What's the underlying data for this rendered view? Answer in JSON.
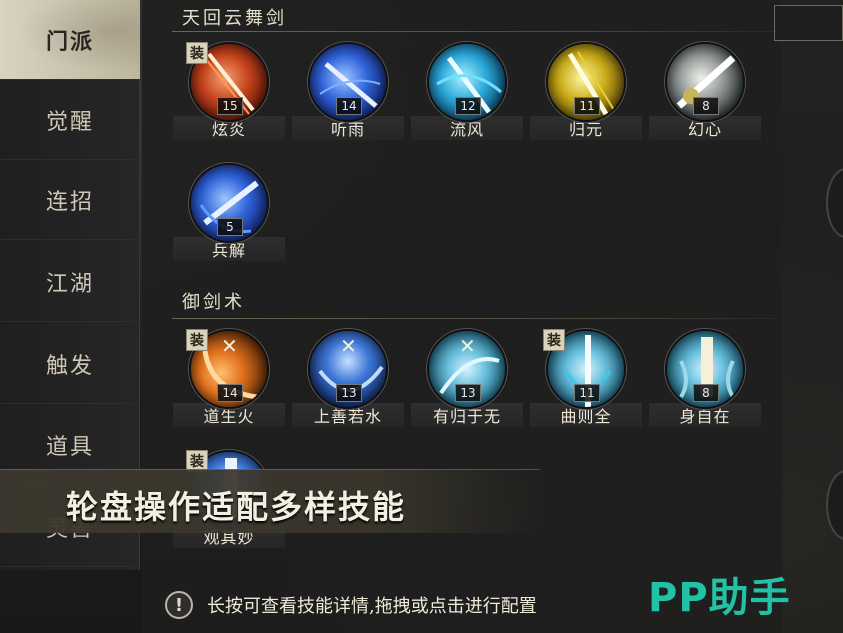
{
  "sidebar": {
    "items": [
      {
        "label": "门派",
        "active": true
      },
      {
        "label": "觉醒"
      },
      {
        "label": "连招"
      },
      {
        "label": "江湖"
      },
      {
        "label": "触发"
      },
      {
        "label": "道具"
      },
      {
        "label": "灵兽"
      }
    ]
  },
  "sections": [
    {
      "title": "天回云舞剑",
      "skills": [
        {
          "name": "炫炎",
          "level": "15",
          "equipped": true,
          "icon": "flame-sword-icon",
          "color": "fire"
        },
        {
          "name": "听雨",
          "level": "14",
          "equipped": false,
          "icon": "rain-sword-icon",
          "color": "blue"
        },
        {
          "name": "流风",
          "level": "12",
          "equipped": false,
          "icon": "wind-sword-icon",
          "color": "cyan"
        },
        {
          "name": "归元",
          "level": "11",
          "equipped": false,
          "icon": "gold-sword-icon",
          "color": "gold"
        },
        {
          "name": "幻心",
          "level": "8",
          "equipped": false,
          "icon": "phantom-sword-icon",
          "color": "steel"
        },
        {
          "name": "兵解",
          "level": "5",
          "equipped": false,
          "icon": "spirit-sword-icon",
          "color": "blue"
        }
      ]
    },
    {
      "title": "御剑术",
      "skills": [
        {
          "name": "道生火",
          "level": "14",
          "equipped": true,
          "icon": "fire-dao-icon",
          "color": "orange"
        },
        {
          "name": "上善若水",
          "level": "13",
          "equipped": false,
          "icon": "water-dao-icon",
          "color": "navy"
        },
        {
          "name": "有归于无",
          "level": "13",
          "equipped": false,
          "icon": "void-dao-icon",
          "color": "teal"
        },
        {
          "name": "曲则全",
          "level": "11",
          "equipped": true,
          "icon": "bent-sword-icon",
          "color": "teal"
        },
        {
          "name": "身自在",
          "level": "8",
          "equipped": false,
          "icon": "free-body-icon",
          "color": "teal"
        },
        {
          "name": "观其妙",
          "level": "",
          "equipped": true,
          "icon": "observe-icon",
          "color": "navy"
        }
      ]
    }
  ],
  "equip_badge": "装",
  "banner": {
    "text": "轮盘操作适配多样技能"
  },
  "hint": {
    "icon": "!",
    "text": "长按可查看技能详情,拖拽或点击进行配置"
  },
  "watermark": "PP助手",
  "colors": {
    "accent": "#21c2a6",
    "active_tab": "#d8d2c0"
  }
}
